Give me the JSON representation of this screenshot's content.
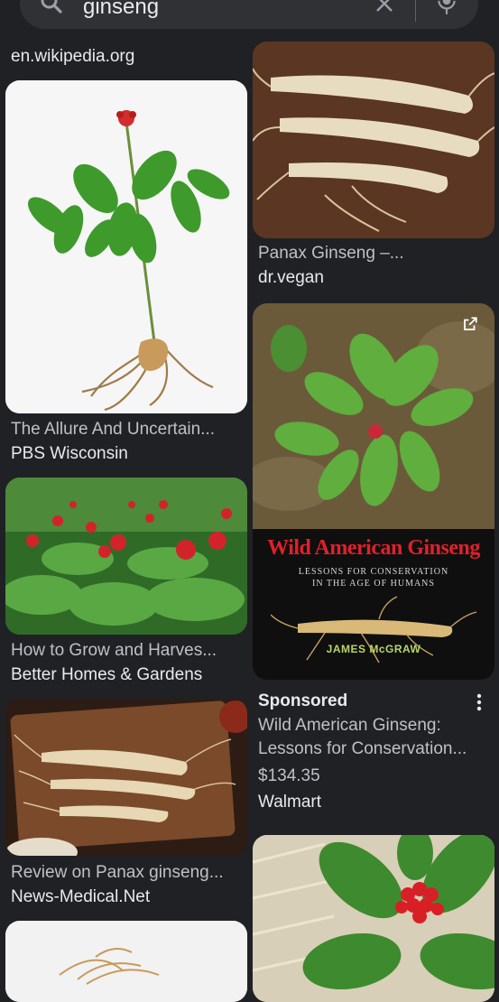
{
  "search": {
    "query": "ginseng"
  },
  "left": {
    "top_source": "en.wikipedia.org",
    "items": [
      {
        "caption": "The Allure And Uncertain...",
        "source": "PBS Wisconsin"
      },
      {
        "caption": "How to Grow and Harves...",
        "source": "Better Homes & Gardens"
      },
      {
        "caption": "Review on Panax ginseng...",
        "source": "News-Medical.Net"
      }
    ]
  },
  "right": {
    "items": [
      {
        "caption": "Panax Ginseng –...",
        "source": "dr.vegan"
      }
    ],
    "book": {
      "title": "Wild American Ginseng",
      "subtitle_1": "LESSONS FOR CONSERVATION",
      "subtitle_2": "IN THE AGE OF HUMANS",
      "author": "JAMES McGRAW"
    },
    "ad": {
      "label": "Sponsored",
      "line_1": "Wild American Ginseng:",
      "line_2": "Lessons for Conservation...",
      "price": "$134.35",
      "store": "Walmart"
    }
  },
  "colors": {
    "background": "#202124",
    "card": "#303134",
    "text": "#e8eaed",
    "subtle": "#bdc1c6",
    "book_red": "#e0202a"
  },
  "icons": [
    "search-icon",
    "clear-icon",
    "mic-icon",
    "external-link-icon",
    "more-options-icon"
  ]
}
